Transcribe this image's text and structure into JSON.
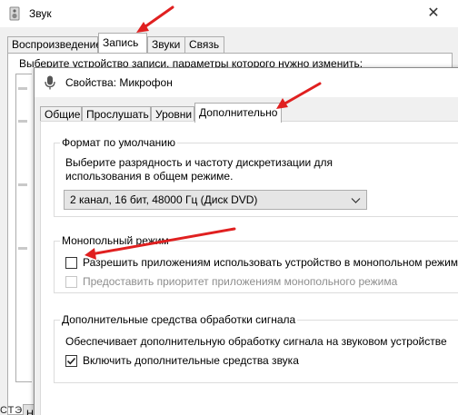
{
  "back_window": {
    "title": "Звук",
    "close_glyph": "✕",
    "tabs": [
      {
        "label": "Воспроизведение"
      },
      {
        "label": "Запись"
      },
      {
        "label": "Звуки"
      },
      {
        "label": "Связь"
      }
    ],
    "active_tab": "Запись",
    "instruction": "Выберите устройство записи, параметры которого нужно изменить:",
    "stub_button": "Н",
    "bottom_text": "СТЭ"
  },
  "dialog": {
    "title": "Свойства: Микрофон",
    "tabs": [
      {
        "label": "Общие"
      },
      {
        "label": "Прослушать"
      },
      {
        "label": "Уровни"
      },
      {
        "label": "Дополнительно"
      }
    ],
    "active_tab": "Дополнительно",
    "default_format": {
      "title": "Формат по умолчанию",
      "description_line1": "Выберите разрядность и частоту дискретизации для",
      "description_line2": "использования в общем режиме.",
      "selected": "2 канал, 16 бит, 48000 Гц (Диск DVD)"
    },
    "exclusive_mode": {
      "title": "Монопольный режим",
      "allow_label": "Разрешить приложениям использовать устройство в монопольном режиме",
      "allow_checked": false,
      "priority_label": "Предоставить приоритет приложениям монопольного режима",
      "priority_checked": false,
      "priority_enabled": false
    },
    "signal_enhancements": {
      "title": "Дополнительные средства обработки сигнала",
      "description": "Обеспечивает дополнительную обработку сигнала на звуковом устройстве",
      "enable_label": "Включить дополнительные средства звука",
      "enable_checked": true
    }
  },
  "colors": {
    "arrow": "#e02020",
    "window_bg": "#f0f0f0",
    "border": "#adadad"
  }
}
